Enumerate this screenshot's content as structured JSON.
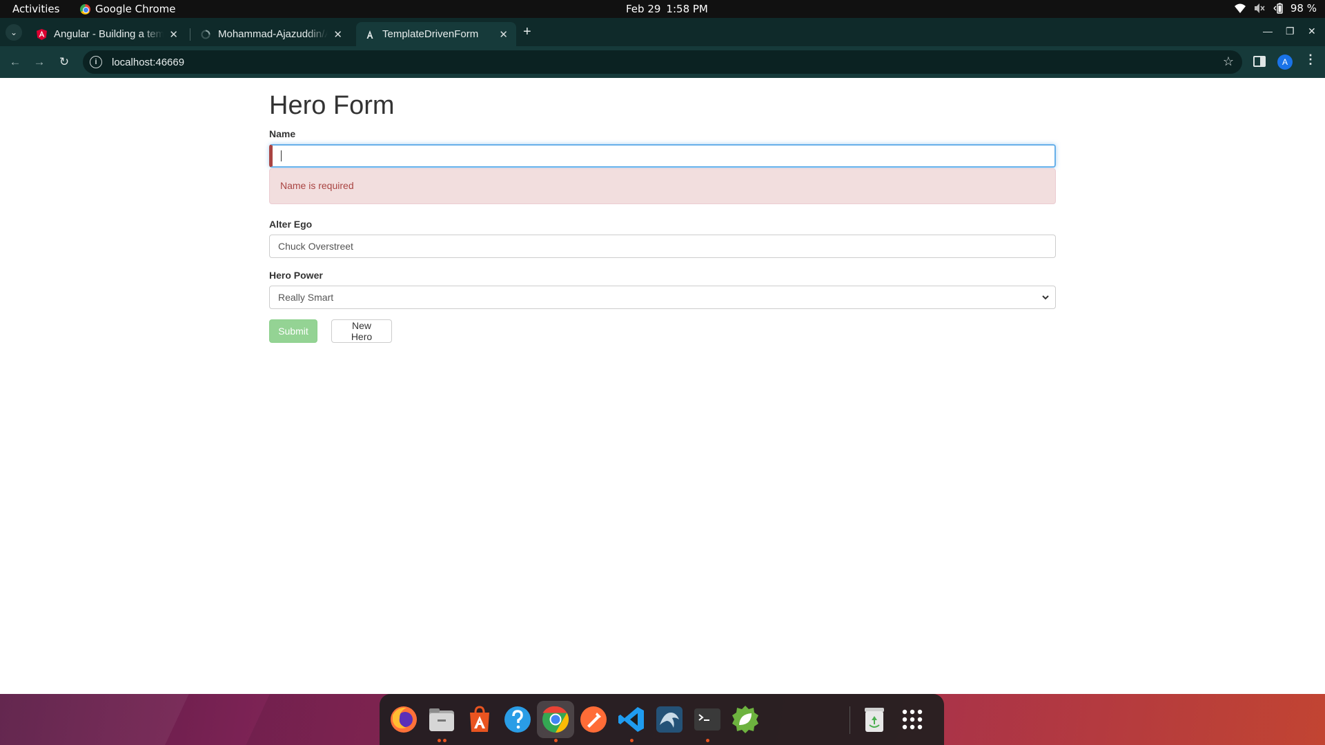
{
  "topbar": {
    "activities": "Activities",
    "app_name": "Google Chrome",
    "date": "Feb 29",
    "time": "1:58 PM",
    "battery": "98 %"
  },
  "tabs": [
    {
      "label": "Angular - Building a template-driven form",
      "active": false
    },
    {
      "label": "Mohammad-Ajazuddin/Angular",
      "active": false
    },
    {
      "label": "TemplateDrivenForm",
      "active": true
    }
  ],
  "toolbar": {
    "url": "localhost:46669"
  },
  "form": {
    "title": "Hero Form",
    "name_label": "Name",
    "name_value": "",
    "name_error": "Name is required",
    "alter_ego_label": "Alter Ego",
    "alter_ego_value": "Chuck Overstreet",
    "power_label": "Hero Power",
    "power_value": "Really Smart",
    "submit_label": "Submit",
    "new_hero_label": "New Hero"
  },
  "dock": {
    "apps": [
      "firefox-icon",
      "files-icon",
      "app-center-icon",
      "help-icon",
      "chrome-icon",
      "postman-icon",
      "vscode-icon",
      "mysql-workbench-icon",
      "terminal-icon",
      "spring-tools-icon",
      "trash-icon",
      "show-apps-icon"
    ]
  },
  "colors": {
    "accent_focus": "#66afe9",
    "error_text": "#a94442",
    "error_bg": "#f2dede",
    "valid_flag": "#42a948",
    "submit_disabled": "#94d394",
    "chrome_frame": "#163a3a"
  }
}
